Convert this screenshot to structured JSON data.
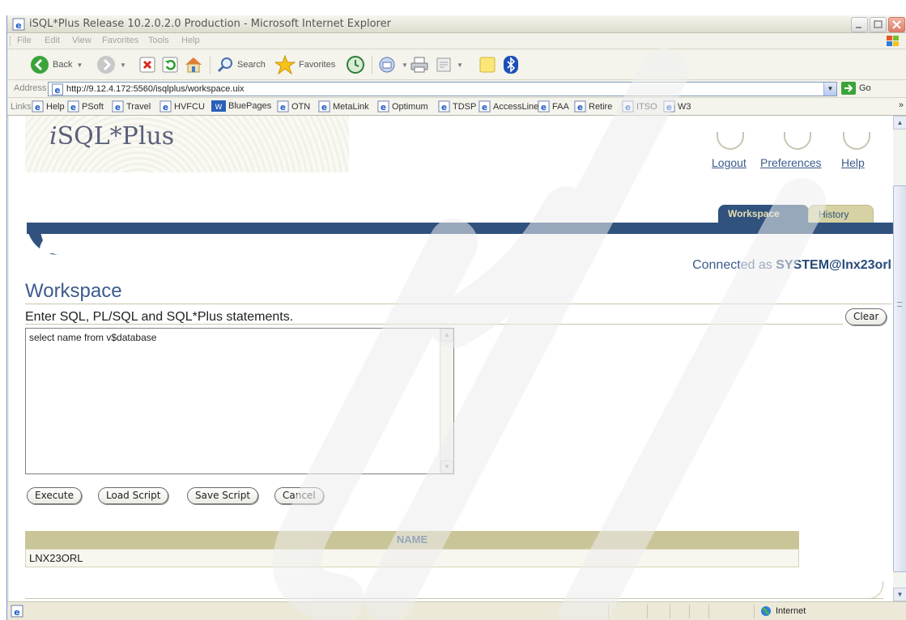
{
  "window": {
    "title": "iSQL*Plus Release 10.2.0.2.0 Production - Microsoft Internet Explorer"
  },
  "menu": [
    "File",
    "Edit",
    "View",
    "Favorites",
    "Tools",
    "Help"
  ],
  "toolbar": {
    "back_label": "Back",
    "search_label": "Search",
    "favorites_label": "Favorites"
  },
  "address": {
    "label": "Address",
    "url": "http://9.12.4.172:5560/isqlplus/workspace.uix",
    "go_label": "Go"
  },
  "links": {
    "label": "Links",
    "items": [
      "Help",
      "PSoft",
      "Travel",
      "HVFCU",
      "BluePages",
      "OTN",
      "MetaLink",
      "Optimum",
      "TDSP",
      "AccessLine",
      "FAA",
      "Retire",
      "ITSO",
      "W3"
    ],
    "more": "»"
  },
  "app": {
    "brand_prefix": "i",
    "brand_rest": "SQL*Plus",
    "global_links": {
      "logout": "Logout",
      "preferences": "Preferences",
      "help": "Help"
    },
    "tabs": {
      "workspace": "Workspace",
      "history": "History"
    },
    "connected_prefix": "Connected as",
    "connected_user": "SYSTEM@lnx23orl",
    "page_title": "Workspace",
    "instructions": "Enter SQL, PL/SQL and SQL*Plus statements.",
    "clear_label": "Clear",
    "sql_text": "select name from v$database",
    "buttons": {
      "execute": "Execute",
      "load_script": "Load Script",
      "save_script": "Save Script",
      "cancel": "Cancel"
    },
    "results": {
      "column": "NAME",
      "rows": [
        "LNX23ORL"
      ]
    }
  },
  "status": {
    "zone": "Internet"
  },
  "colors": {
    "oracle_blue": "#30527d",
    "tab_text": "#e8dfb0",
    "results_header": "#cac598",
    "link_blue": "#3c5b8d"
  },
  "icons": {
    "page": "ie-page-icon",
    "back": "back-arrow-icon",
    "forward": "forward-arrow-icon",
    "stop": "stop-icon",
    "refresh": "refresh-icon",
    "home": "home-icon",
    "search": "search-icon",
    "favorites": "favorites-star-icon",
    "history": "history-icon",
    "mail": "mail-icon",
    "print": "printer-icon",
    "edit": "edit-icon",
    "notes": "notes-icon",
    "bluetooth": "bluetooth-icon",
    "globe": "internet-globe-icon"
  }
}
